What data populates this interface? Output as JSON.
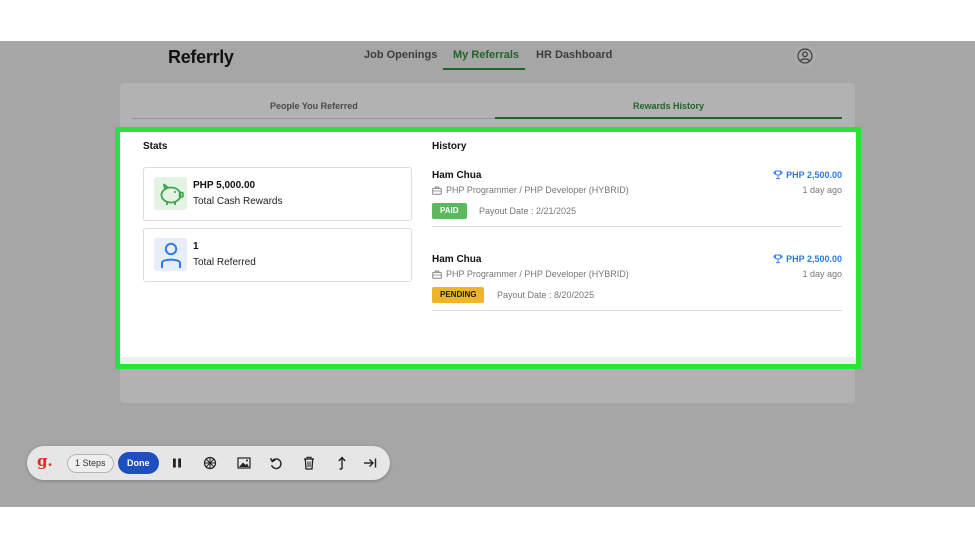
{
  "app": {
    "logo": "Referrly",
    "nav": [
      {
        "label": "Job Openings"
      },
      {
        "label": "My Referrals"
      },
      {
        "label": "HR Dashboard"
      }
    ]
  },
  "subtabs": [
    {
      "label": "People You Referred"
    },
    {
      "label": "Rewards History"
    }
  ],
  "stats": {
    "title": "Stats",
    "items": [
      {
        "value": "PHP 5,000.00",
        "label": "Total Cash Rewards",
        "icon": "piggy-bank-icon"
      },
      {
        "value": "1",
        "label": "Total Referred",
        "icon": "user-icon"
      }
    ]
  },
  "history": {
    "title": "History",
    "items": [
      {
        "name": "Ham Chua",
        "job": "PHP Programmer / PHP Developer (HYBRID)",
        "amount": "PHP 2,500.00",
        "time": "1 day ago",
        "status": "PAID",
        "payout": "Payout Date : 2/21/2025"
      },
      {
        "name": "Ham Chua",
        "job": "PHP Programmer / PHP Developer (HYBRID)",
        "amount": "PHP 2,500.00",
        "time": "1 day ago",
        "status": "PENDING",
        "payout": "Payout Date : 8/20/2025"
      }
    ]
  },
  "toolbar": {
    "logo": "g.",
    "steps": "1 Steps",
    "done": "Done",
    "icons": [
      "pause-icon",
      "blur-icon",
      "image-icon",
      "undo-icon",
      "trash-icon",
      "arrow-up-icon",
      "skip-end-icon"
    ]
  },
  "colors": {
    "accent": "#2e8b3a",
    "highlight": "#27e33a",
    "link": "#2c7be5",
    "paid": "#5cb85c",
    "pending": "#f0b429",
    "done": "#1f4fbf"
  }
}
